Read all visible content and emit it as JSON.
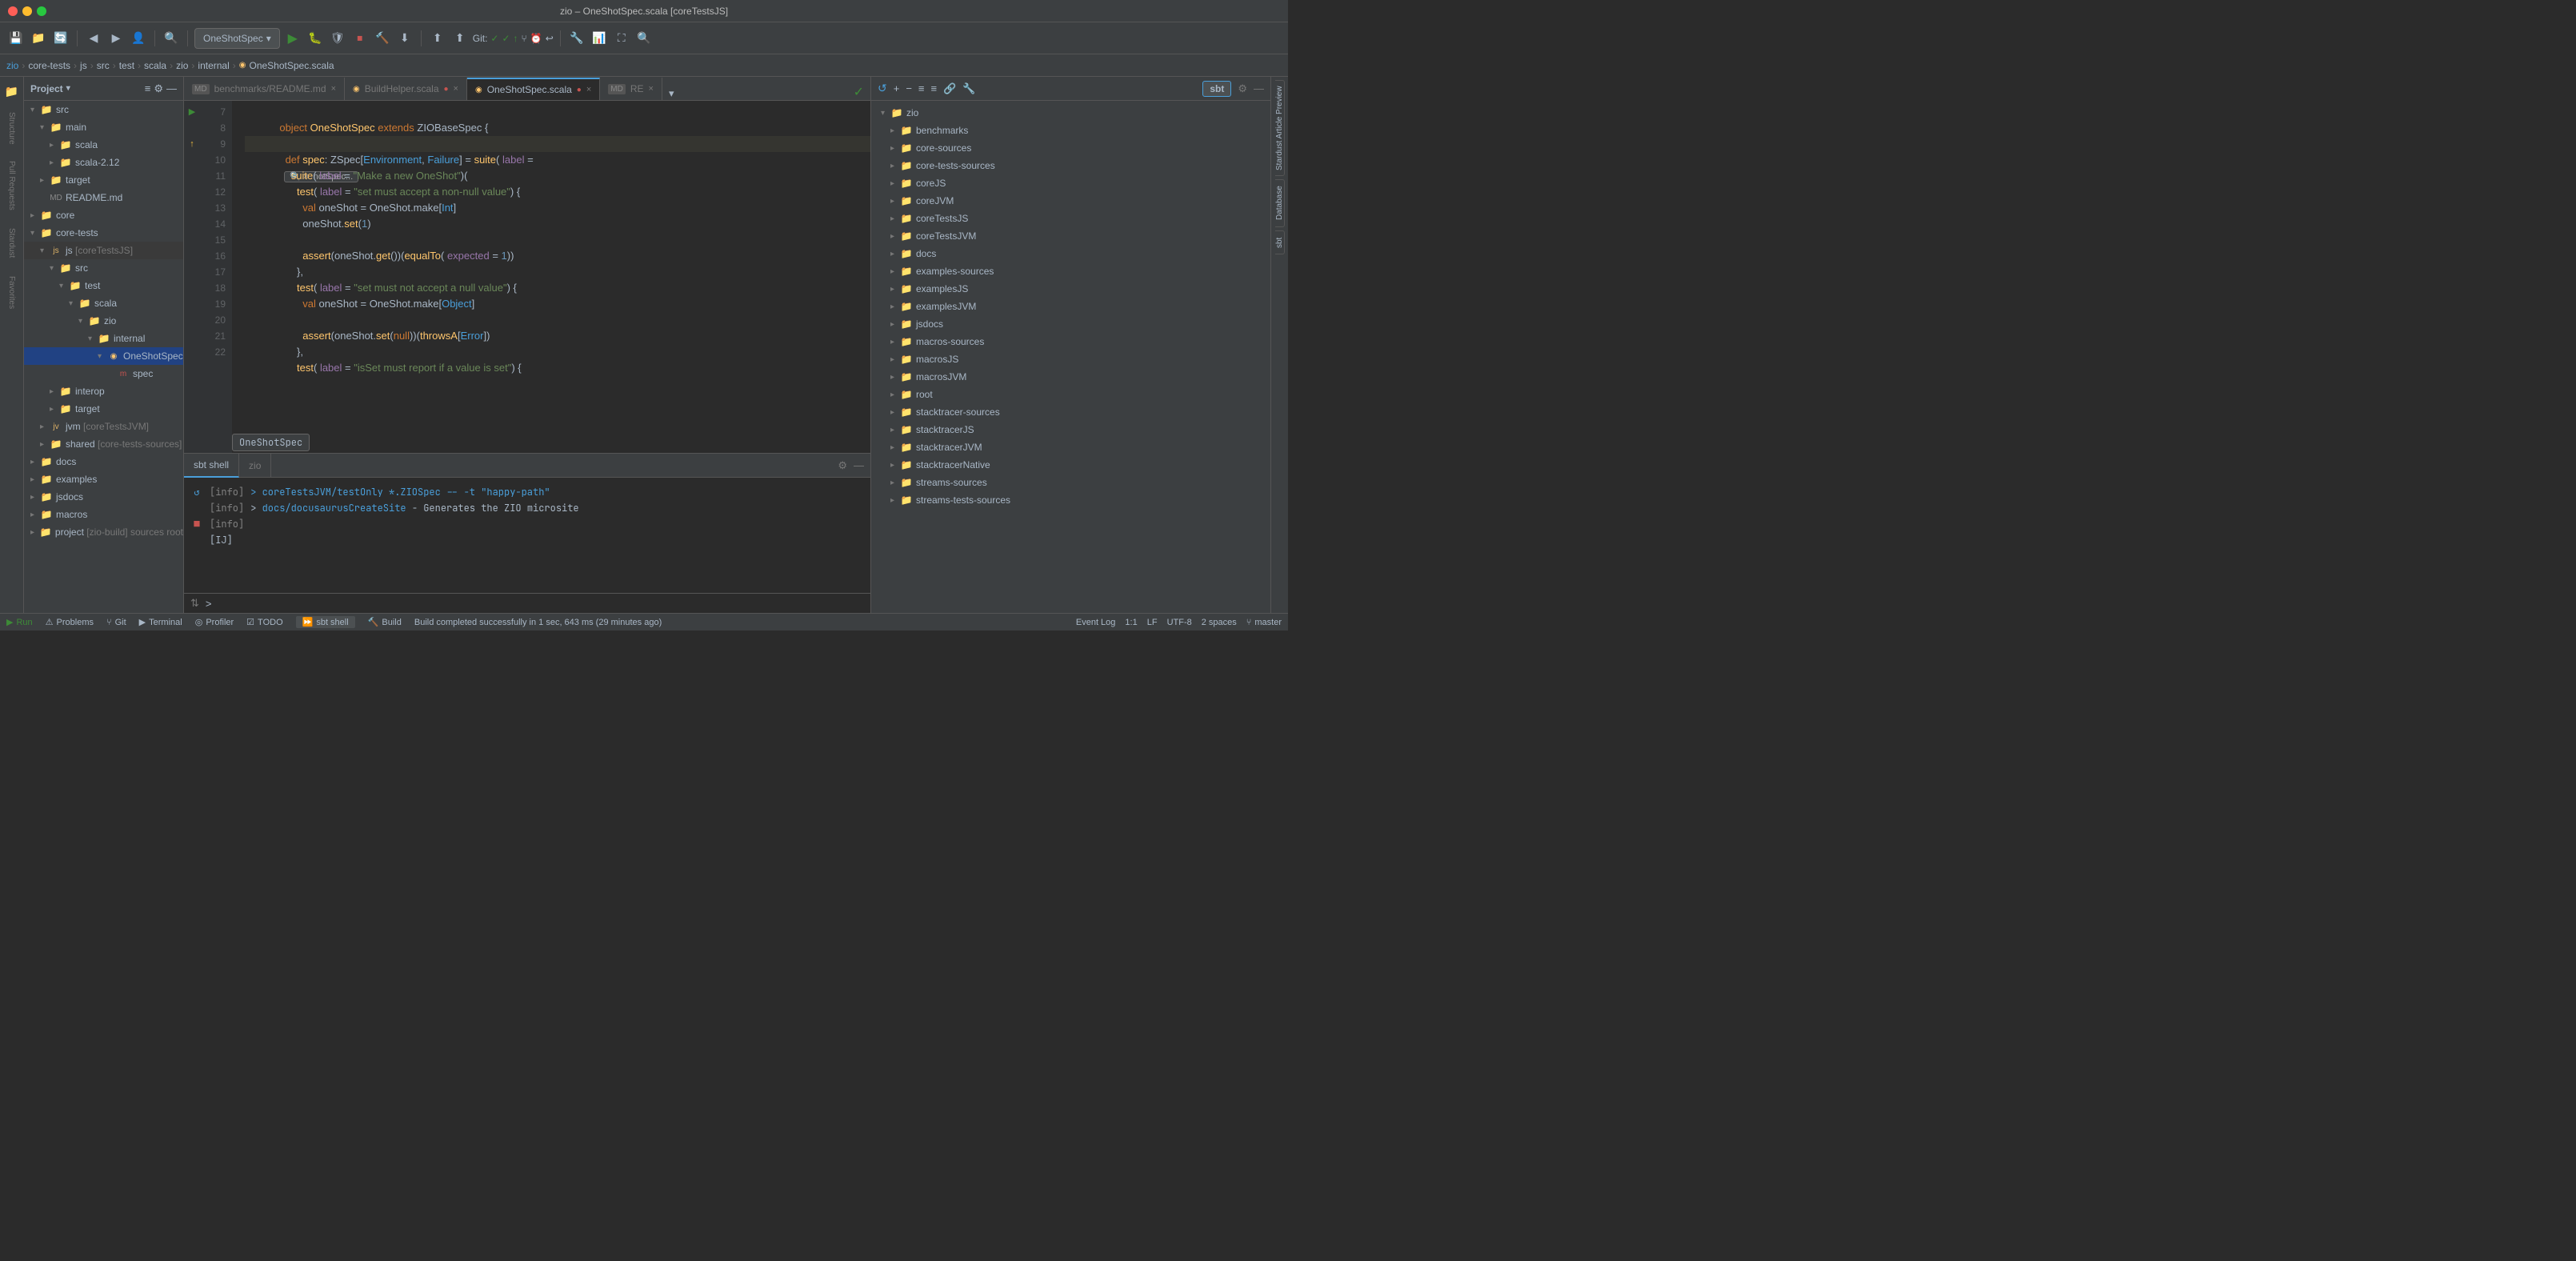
{
  "window": {
    "title": "zio – OneShotSpec.scala [coreTestsJS]"
  },
  "titlebar": {
    "title": "zio – OneShotSpec.scala [coreTestsJS]"
  },
  "toolbar": {
    "run_config": "OneShotSpec",
    "git_label": "Git:",
    "run_icon": "▶",
    "build_icon": "🔨",
    "stop_icon": "⏹"
  },
  "breadcrumb": {
    "items": [
      "zio",
      "core-tests",
      "js",
      "src",
      "test",
      "scala",
      "zio",
      "internal",
      "OneShotSpec.scala"
    ]
  },
  "sidebar": {
    "title": "Project",
    "tree": [
      {
        "level": 1,
        "type": "folder",
        "name": "src",
        "open": true
      },
      {
        "level": 2,
        "type": "folder",
        "name": "main",
        "open": true
      },
      {
        "level": 3,
        "type": "folder",
        "name": "scala",
        "open": false
      },
      {
        "level": 3,
        "type": "folder",
        "name": "scala-2.12",
        "open": false
      },
      {
        "level": 2,
        "type": "folder",
        "name": "target",
        "open": false
      },
      {
        "level": 2,
        "type": "file-md",
        "name": "README.md"
      },
      {
        "level": 1,
        "type": "folder",
        "name": "core",
        "open": false
      },
      {
        "level": 1,
        "type": "folder",
        "name": "core-tests",
        "open": true
      },
      {
        "level": 2,
        "type": "folder-js",
        "name": "js [coreTestsJS]",
        "open": true
      },
      {
        "level": 3,
        "type": "folder",
        "name": "src",
        "open": true
      },
      {
        "level": 4,
        "type": "folder",
        "name": "test",
        "open": true
      },
      {
        "level": 5,
        "type": "folder",
        "name": "scala",
        "open": true
      },
      {
        "level": 6,
        "type": "folder",
        "name": "zio",
        "open": true
      },
      {
        "level": 7,
        "type": "folder",
        "name": "internal",
        "open": true
      },
      {
        "level": 8,
        "type": "file-scala",
        "name": "OneShotSpec",
        "selected": true
      },
      {
        "level": 9,
        "type": "file-m",
        "name": "spec"
      },
      {
        "level": 3,
        "type": "folder",
        "name": "interop",
        "open": false
      },
      {
        "level": 3,
        "type": "folder",
        "name": "target",
        "open": false
      },
      {
        "level": 2,
        "type": "folder-jvm",
        "name": "jvm [coreTestsJVM]",
        "open": false
      },
      {
        "level": 2,
        "type": "folder-shared",
        "name": "shared [core-tests-sources]",
        "open": false
      },
      {
        "level": 1,
        "type": "folder",
        "name": "docs",
        "open": false
      },
      {
        "level": 1,
        "type": "folder",
        "name": "examples",
        "open": false
      },
      {
        "level": 1,
        "type": "folder",
        "name": "jsdocs",
        "open": false
      },
      {
        "level": 1,
        "type": "folder",
        "name": "macros",
        "open": false
      },
      {
        "level": 1,
        "type": "folder-build",
        "name": "project [zio-build] sources root",
        "open": false
      }
    ]
  },
  "editor": {
    "tabs": [
      {
        "name": "benchmarks/README.md",
        "type": "md",
        "active": false,
        "modified": false
      },
      {
        "name": "BuildHelper.scala",
        "type": "scala",
        "active": false,
        "modified": true
      },
      {
        "name": "OneShotSpec.scala",
        "type": "scala",
        "active": true,
        "modified": true
      },
      {
        "name": "RE",
        "type": "md",
        "active": false,
        "modified": false
      }
    ],
    "code_lines": [
      {
        "num": 7,
        "content": "object OneShotSpec extends ZIOBaseSpec {"
      },
      {
        "num": 8,
        "content": ""
      },
      {
        "num": 9,
        "content": "  def spec: ZSpec[Environment, Failure] = suite( label ="
      },
      {
        "num": 10,
        "content": "    suite( label = \"Make a new OneShot\")("
      },
      {
        "num": 11,
        "content": "      test( label = \"set must accept a non-null value\") {"
      },
      {
        "num": 12,
        "content": "        val oneShot = OneShot.make[Int]"
      },
      {
        "num": 13,
        "content": "        oneShot.set(1)"
      },
      {
        "num": 14,
        "content": ""
      },
      {
        "num": 15,
        "content": "        assert(oneShot.get())(equalTo( expected = 1))"
      },
      {
        "num": 16,
        "content": "      },"
      },
      {
        "num": 17,
        "content": "      test( label = \"set must not accept a null value\") {"
      },
      {
        "num": 18,
        "content": "        val oneShot = OneShot.make[Object]"
      },
      {
        "num": 19,
        "content": ""
      },
      {
        "num": 20,
        "content": "        assert(oneShot.set(null))(throwsA[Error])"
      },
      {
        "num": 21,
        "content": "      },"
      },
      {
        "num": 22,
        "content": "      test( label = \"isSet must report if a value is set\") {"
      }
    ],
    "filename_tooltip": "OneShotSpec"
  },
  "sbt_panel": {
    "title": "sbt",
    "tree_items": [
      "zio",
      "benchmarks",
      "core-sources",
      "core-tests-sources",
      "coreJS",
      "coreJVM",
      "coreTestsJS",
      "coreTestsJVM",
      "docs",
      "examples-sources",
      "examplesJS",
      "examplesJVM",
      "jsdocs",
      "macros-sources",
      "macrosJS",
      "macrosJVM",
      "root",
      "stacktracer-sources",
      "stacktracerJS",
      "stacktracerJVM",
      "stacktracerNative",
      "streams-sources",
      "streams-tests-sources"
    ]
  },
  "bottom_panel": {
    "tabs": [
      {
        "name": "sbt shell",
        "active": true
      },
      {
        "name": "zio",
        "active": false
      }
    ],
    "console_lines": [
      {
        "type": "info",
        "text": "> coreTestsJVM/testOnly *.ZIOSpec -- -t \"happy-path\""
      },
      {
        "type": "info",
        "text": "> docs/docusaurusCreateSite - Generates the ZIO microsite"
      },
      {
        "type": "info",
        "text": ""
      },
      {
        "type": "ij",
        "text": "[IJ]"
      }
    ],
    "prompt": ">",
    "settings_icon": "⚙",
    "close_icon": "×"
  },
  "status_bar": {
    "run_label": "Run",
    "problems_label": "Problems",
    "git_label": "Git",
    "terminal_label": "Terminal",
    "profiler_label": "Profiler",
    "todo_label": "TODO",
    "sbt_shell_label": "sbt shell",
    "build_label": "Build",
    "event_log_label": "Event Log",
    "position": "1:1",
    "line_ending": "LF",
    "encoding": "UTF-8",
    "indent": "2 spaces",
    "branch": "master",
    "build_status": "Build completed successfully in 1 sec, 643 ms (29 minutes ago)"
  },
  "right_sidebar": {
    "tabs": [
      "Stardust Article Preview",
      "Database",
      "sbt"
    ]
  }
}
